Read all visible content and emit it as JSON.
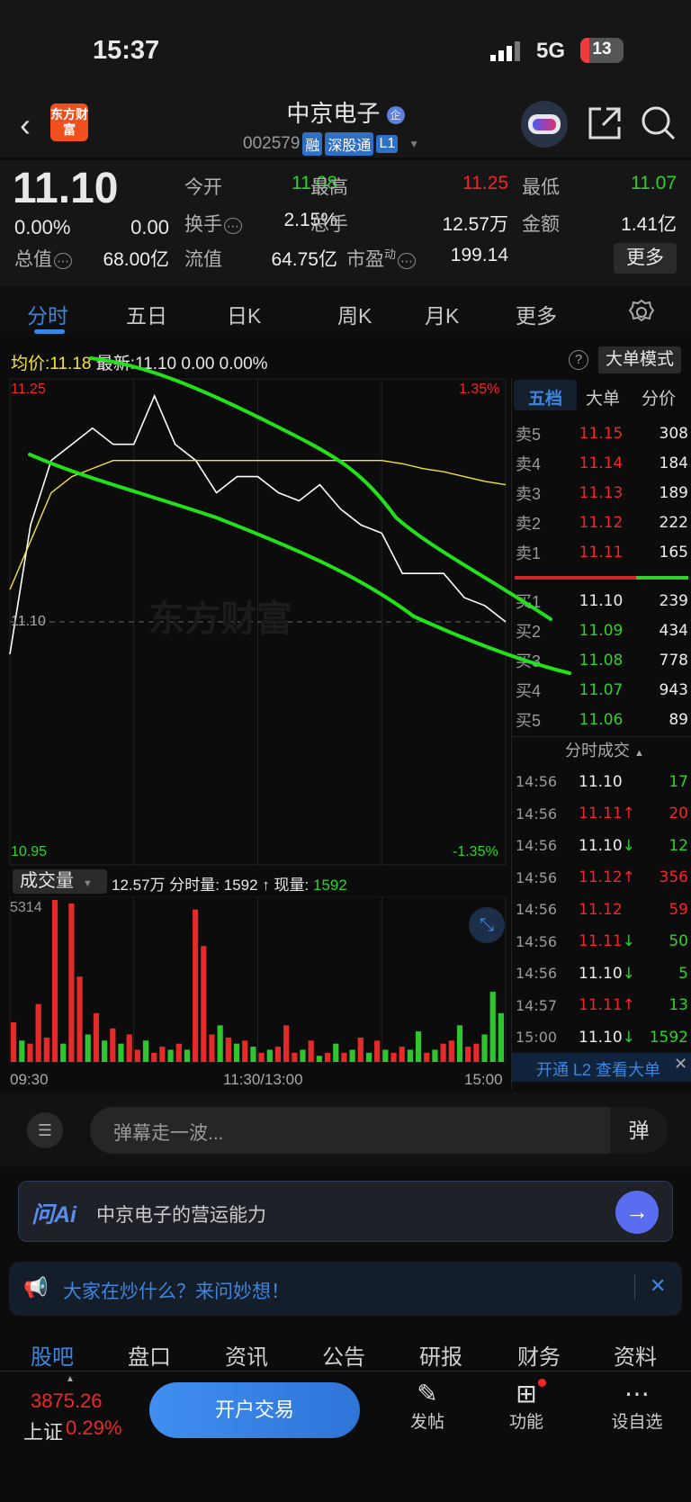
{
  "status": {
    "time": "15:37",
    "network": "5G",
    "battery": "13"
  },
  "header": {
    "logo": "东方财富",
    "name": "中京电子",
    "name_badge": "企",
    "code": "002579",
    "tags": [
      "融",
      "深股通",
      "L1"
    ]
  },
  "quote": {
    "price": "11.10",
    "change_pct": "0.00%",
    "change": "0.00",
    "fields": [
      {
        "label": "今开",
        "value": "11.08",
        "color": "green"
      },
      {
        "label": "最高",
        "value": "11.25",
        "color": "red"
      },
      {
        "label": "最低",
        "value": "11.07",
        "color": "green"
      },
      {
        "label": "换手",
        "value": "2.15%",
        "color": "white"
      },
      {
        "label": "总手",
        "value": "12.57万",
        "color": "white"
      },
      {
        "label": "金额",
        "value": "1.41亿",
        "color": "white"
      },
      {
        "label": "总值",
        "value": "68.00亿",
        "color": "white"
      },
      {
        "label": "流值",
        "value": "64.75亿",
        "color": "white"
      },
      {
        "label": "市盈",
        "label_sup": "动",
        "value": "199.14",
        "color": "white"
      }
    ],
    "more_label": "更多"
  },
  "chart_tabs": {
    "items": [
      "分时",
      "五日",
      "日K",
      "周K",
      "月K",
      "更多"
    ],
    "active": 0
  },
  "info_line": {
    "avg_label": "均价:",
    "avg": "11.18",
    "latest_label": "最新:",
    "latest": "11.10",
    "chg": "0.00",
    "pct": "0.00%",
    "mode_button": "大单模式"
  },
  "chart_data": {
    "type": "line",
    "y_labels": {
      "top": "11.25",
      "bottom": "10.95",
      "mid": "11.10",
      "top_pct": "1.35%",
      "bottom_pct": "-1.35%"
    },
    "ylim": [
      10.95,
      11.25
    ],
    "x": [
      "09:30",
      "09:40",
      "09:50",
      "10:00",
      "10:10",
      "10:20",
      "10:30",
      "10:40",
      "10:50",
      "11:00",
      "11:10",
      "11:20",
      "11:30",
      "13:10",
      "13:20",
      "13:30",
      "13:40",
      "13:50",
      "14:00",
      "14:10",
      "14:20",
      "14:30",
      "14:40",
      "14:50",
      "15:00"
    ],
    "series": [
      {
        "name": "最新",
        "color": "#ffffff",
        "values": [
          11.08,
          11.16,
          11.2,
          11.21,
          11.22,
          11.21,
          11.21,
          11.24,
          11.21,
          11.2,
          11.18,
          11.19,
          11.19,
          11.18,
          11.175,
          11.185,
          11.17,
          11.16,
          11.155,
          11.13,
          11.13,
          11.13,
          11.115,
          11.11,
          11.1
        ]
      },
      {
        "name": "均价",
        "color": "#f5e33a",
        "values": [
          11.12,
          11.15,
          11.18,
          11.19,
          11.195,
          11.2,
          11.2,
          11.2,
          11.2,
          11.2,
          11.2,
          11.2,
          11.2,
          11.2,
          11.2,
          11.2,
          11.2,
          11.2,
          11.2,
          11.198,
          11.195,
          11.193,
          11.19,
          11.187,
          11.185
        ]
      }
    ],
    "volume": {
      "label": "成交量",
      "total": "12.57万",
      "period_label": "分时量:",
      "period": "1592",
      "now_label": "现量:",
      "now": "1592",
      "max_label": "5314",
      "ymax": 5314,
      "values": [
        1300,
        700,
        600,
        1900,
        800,
        5314,
        600,
        5200,
        2800,
        900,
        1600,
        700,
        1100,
        600,
        900,
        400,
        700,
        300,
        500,
        400,
        600,
        400,
        5000,
        3800,
        900,
        1200,
        800,
        600,
        700,
        500,
        300,
        400,
        500,
        1200,
        300,
        400,
        700,
        200,
        300,
        600,
        300,
        400,
        800,
        300,
        700,
        400,
        300,
        500,
        400,
        1000,
        300,
        400,
        600,
        700,
        1200,
        500,
        600,
        900,
        2300,
        1600
      ],
      "up": [
        1,
        0,
        1,
        1,
        1,
        1,
        0,
        1,
        1,
        0,
        1,
        0,
        1,
        0,
        1,
        1,
        0,
        1,
        1,
        0,
        1,
        0,
        1,
        1,
        1,
        0,
        1,
        0,
        1,
        0,
        1,
        0,
        1,
        1,
        1,
        0,
        1,
        0,
        1,
        0,
        1,
        0,
        1,
        0,
        1,
        0,
        1,
        1,
        0,
        0,
        1,
        0,
        1,
        1,
        0,
        1,
        1,
        0,
        0,
        0
      ]
    },
    "x_labels": [
      "09:30",
      "11:30/13:00",
      "15:00"
    ]
  },
  "order_book": {
    "tabs": [
      "五档",
      "大单",
      "分价"
    ],
    "asks": [
      {
        "label": "卖5",
        "price": "11.15",
        "vol": "308"
      },
      {
        "label": "卖4",
        "price": "11.14",
        "vol": "184"
      },
      {
        "label": "卖3",
        "price": "11.13",
        "vol": "189"
      },
      {
        "label": "卖2",
        "price": "11.12",
        "vol": "222"
      },
      {
        "label": "卖1",
        "price": "11.11",
        "vol": "165"
      }
    ],
    "bids": [
      {
        "label": "买1",
        "price": "11.10",
        "vol": "239",
        "color": "white"
      },
      {
        "label": "买2",
        "price": "11.09",
        "vol": "434",
        "color": "green"
      },
      {
        "label": "买3",
        "price": "11.08",
        "vol": "778",
        "color": "green"
      },
      {
        "label": "买4",
        "price": "11.07",
        "vol": "943",
        "color": "green"
      },
      {
        "label": "买5",
        "price": "11.06",
        "vol": "89",
        "color": "green"
      }
    ],
    "ratio_buy": 0.3
  },
  "trades": {
    "title": "分时成交",
    "rows": [
      {
        "time": "14:56",
        "price": "11.10",
        "arrow": "",
        "pc": "white",
        "vol": "17",
        "vc": "green"
      },
      {
        "time": "14:56",
        "price": "11.11",
        "arrow": "↑",
        "pc": "red",
        "vol": "20",
        "vc": "red"
      },
      {
        "time": "14:56",
        "price": "11.10",
        "arrow": "↓",
        "pc": "white",
        "vol": "12",
        "vc": "green"
      },
      {
        "time": "14:56",
        "price": "11.12",
        "arrow": "↑",
        "pc": "red",
        "vol": "356",
        "vc": "red"
      },
      {
        "time": "14:56",
        "price": "11.12",
        "arrow": "",
        "pc": "red",
        "vol": "59",
        "vc": "red"
      },
      {
        "time": "14:56",
        "price": "11.11",
        "arrow": "↓",
        "pc": "red",
        "vol": "50",
        "vc": "green"
      },
      {
        "time": "14:56",
        "price": "11.10",
        "arrow": "↓",
        "pc": "white",
        "vol": "5",
        "vc": "green"
      },
      {
        "time": "14:57",
        "price": "11.11",
        "arrow": "↑",
        "pc": "red",
        "vol": "13",
        "vc": "green"
      },
      {
        "time": "15:00",
        "price": "11.10",
        "arrow": "↓",
        "pc": "white",
        "vol": "1592",
        "vc": "green"
      }
    ],
    "l2_banner": "开通 L2 查看大单"
  },
  "danmaku": {
    "placeholder": "弹幕走一波...",
    "button": "弹"
  },
  "ai": {
    "logo": "问Ai",
    "prompt": "中京电子的营运能力"
  },
  "banner": {
    "text": "大家在炒什么？来问妙想！"
  },
  "bottom_tabs": {
    "items": [
      "股吧",
      "盘口",
      "资讯",
      "公告",
      "研报",
      "财务",
      "资料"
    ],
    "active": 0
  },
  "footer": {
    "index_value": "3875.26",
    "index_name": "上证",
    "index_pct": "0.29%",
    "trade_button": "开户交易",
    "actions": [
      "发帖",
      "功能",
      "设自选"
    ]
  },
  "colors": {
    "red": "#f0262a",
    "green": "#2fd02f",
    "blue": "#3d86e0",
    "avg": "#f5e33a",
    "annotation": "#22e01a"
  }
}
